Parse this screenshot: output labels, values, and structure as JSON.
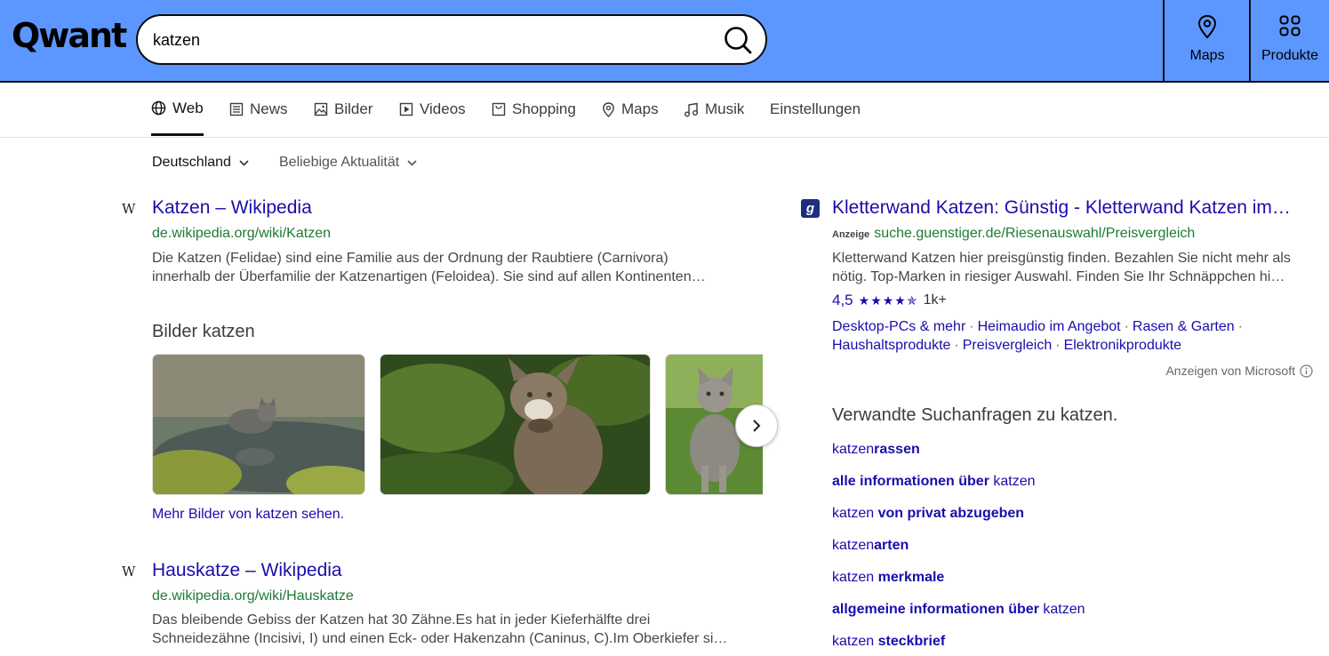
{
  "header": {
    "logo": "Qwant",
    "search_value": "katzen",
    "maps_label": "Maps",
    "products_label": "Produkte"
  },
  "tabs": [
    {
      "label": "Web",
      "icon": "globe-icon"
    },
    {
      "label": "News",
      "icon": "news-icon"
    },
    {
      "label": "Bilder",
      "icon": "image-icon"
    },
    {
      "label": "Videos",
      "icon": "video-icon"
    },
    {
      "label": "Shopping",
      "icon": "shopping-icon"
    },
    {
      "label": "Maps",
      "icon": "map-pin-icon"
    },
    {
      "label": "Musik",
      "icon": "music-icon"
    },
    {
      "label": "Einstellungen",
      "icon": ""
    }
  ],
  "filters": {
    "region": "Deutschland",
    "time": "Beliebige Aktualität"
  },
  "results": [
    {
      "icon": "W",
      "title": "Katzen – Wikipedia",
      "url": "de.wikipedia.org/wiki/Katzen",
      "snippet_1": "Die Katzen (Felidae) sind eine Familie aus der Ordnung der Raubtiere (Carnivora)",
      "snippet_2": "innerhalb der Überfamilie der Katzenartigen (Feloidea). Sie sind auf allen Kontinenten…"
    },
    {
      "icon": "W",
      "title": "Hauskatze – Wikipedia",
      "url": "de.wikipedia.org/wiki/Hauskatze",
      "snippet_1": "Das bleibende Gebiss der Katzen hat 30 Zähne.Es hat in jeder Kieferhälfte drei",
      "snippet_2": "Schneidezähne (Incisivi, I) und einen Eck- oder Hakenzahn (Caninus, C).Im Oberkiefer si…"
    }
  ],
  "images": {
    "heading": "Bilder katzen",
    "more_link": "Mehr Bilder von katzen sehen."
  },
  "ad": {
    "logo_letter": "g",
    "title": "Kletterwand Katzen: Günstig - Kletterwand Katzen im…",
    "badge": "Anzeige",
    "url": "suche.guenstiger.de/Riesenauswahl/Preisvergleich",
    "snippet_1": "Kletterwand Katzen hier preisgünstig finden. Bezahlen Sie nicht mehr als",
    "snippet_2": "nötig. Top-Marken in riesiger Auswahl. Finden Sie Ihr Schnäppchen hi…",
    "rating_value": "4,5",
    "rating_stars": "★★★★✯",
    "rating_count": "1k+",
    "sitelinks": [
      "Desktop-PCs & mehr",
      "Heimaudio im Angebot",
      "Rasen & Garten",
      "Haushaltsprodukte",
      "Preisvergleich",
      "Elektronikprodukte"
    ],
    "ads_by": "Anzeigen von Microsoft"
  },
  "related": {
    "title": "Verwandte Suchanfragen zu katzen.",
    "items": [
      {
        "pre": "katzen",
        "bold": "rassen",
        "post": ""
      },
      {
        "pre": "",
        "bold": "alle informationen über",
        "post": " katzen"
      },
      {
        "pre": "katzen ",
        "bold": "von privat abzugeben",
        "post": ""
      },
      {
        "pre": "katzen",
        "bold": "arten",
        "post": ""
      },
      {
        "pre": "katzen ",
        "bold": "merkmale",
        "post": ""
      },
      {
        "pre": "",
        "bold": "allgemeine informationen über",
        "post": " katzen"
      },
      {
        "pre": "katzen ",
        "bold": "steckbrief",
        "post": ""
      }
    ]
  },
  "colors": {
    "header_bg": "#5c97ff",
    "link": "#1a0dab",
    "url": "#1e7a36"
  }
}
